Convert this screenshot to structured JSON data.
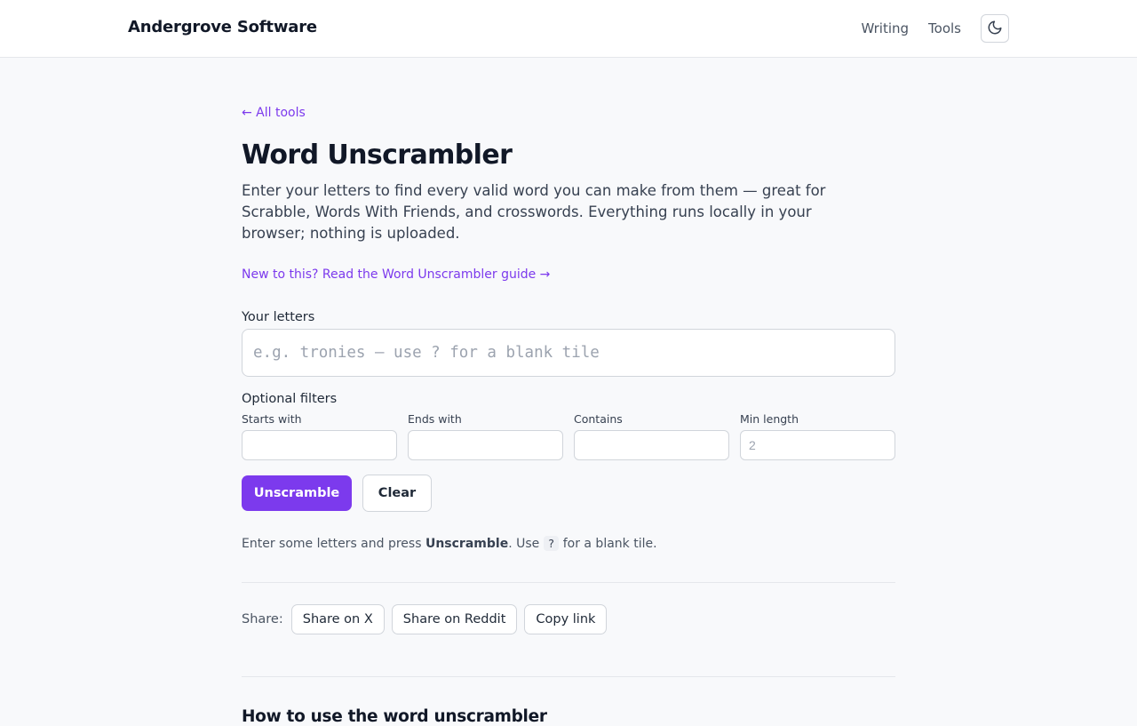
{
  "header": {
    "brand": "Andergrove Software",
    "nav": [
      "Writing",
      "Tools"
    ],
    "theme_icon": "moon-icon"
  },
  "main": {
    "back_link": "← All tools",
    "title": "Word Unscrambler",
    "intro": "Enter your letters to find every valid word you can make from them — great for Scrabble, Words With Friends, and crosswords. Everything runs locally in your browser; nothing is uploaded.",
    "guide_link": "New to this? Read the Word Unscrambler guide →",
    "letters_label": "Your letters",
    "letters_placeholder": "e.g. tronies — use ? for a blank tile",
    "letters_value": "",
    "filters_title": "Optional filters",
    "filters": {
      "starts_label": "Starts with",
      "starts_value": "",
      "ends_label": "Ends with",
      "ends_value": "",
      "contains_label": "Contains",
      "contains_value": "",
      "min_label": "Min length",
      "min_placeholder": "2",
      "min_value": ""
    },
    "unscramble_label": "Unscramble",
    "clear_label": "Clear",
    "hint": {
      "before": "Enter some letters and press ",
      "bold": "Unscramble",
      "middle": ". Use ",
      "code": "?",
      "after": " for a blank tile."
    },
    "share": {
      "label": "Share:",
      "x": "Share on X",
      "reddit": "Share on Reddit",
      "copy": "Copy link"
    },
    "how_to_heading": "How to use the word unscrambler"
  }
}
